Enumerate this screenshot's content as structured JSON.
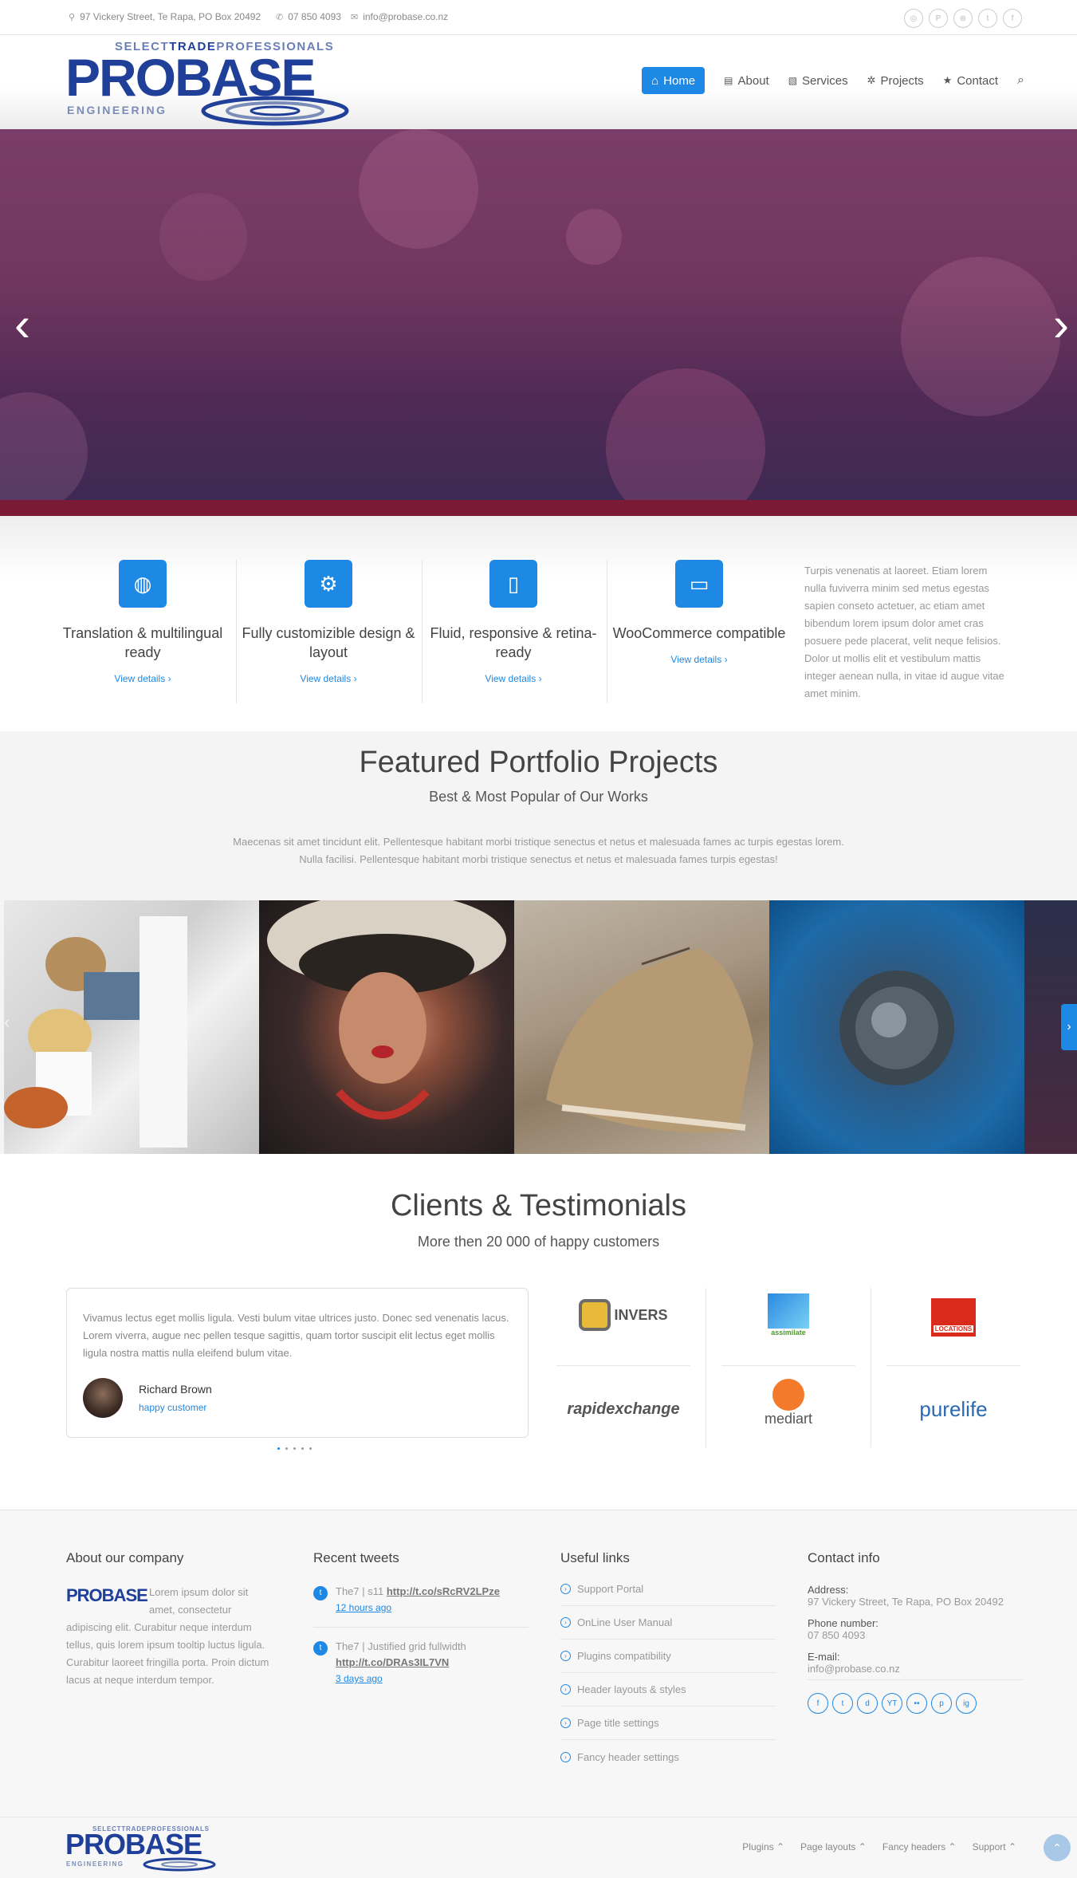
{
  "topbar": {
    "address": "97 Vickery Street, Te Rapa, PO Box 20492",
    "phone": "07 850 4093",
    "email": "info@probase.co.nz",
    "social_icons": [
      "instagram-icon",
      "pinterest-icon",
      "dribbble-icon",
      "twitter-icon",
      "facebook-icon"
    ]
  },
  "logo": {
    "tagline_select": "SELECT",
    "tagline_trade": "TRADE",
    "tagline_professionals": "PROFESSIONALS",
    "name": "PROBASE",
    "sub": "ENGINEERING"
  },
  "nav": {
    "items": [
      {
        "label": "Home",
        "icon": "home-icon",
        "active": true
      },
      {
        "label": "About",
        "icon": "document-icon"
      },
      {
        "label": "Services",
        "icon": "image-icon"
      },
      {
        "label": "Projects",
        "icon": "gear-icon"
      },
      {
        "label": "Contact",
        "icon": "star-icon"
      }
    ]
  },
  "features": [
    {
      "title": "Translation & multilingual ready",
      "link": "View details"
    },
    {
      "title": "Fully customizible design & layout",
      "link": "View details"
    },
    {
      "title": "Fluid, responsive & retina-ready",
      "link": "View details"
    },
    {
      "title": "WooCommerce compatible",
      "link": "View details"
    }
  ],
  "features_text": "Turpis venenatis at laoreet. Etiam lorem nulla fuviverra minim sed metus egestas sapien conseto actetuer, ac etiam amet bibendum lorem ipsum dolor amet cras posuere pede placerat, velit neque felisios. Dolor ut mollis elit et vestibulum mattis integer aenean nulla, in vitae id augue vitae amet minim.",
  "portfolio": {
    "title": "Featured Portfolio Projects",
    "subtitle": "Best & Most Popular of Our Works",
    "text_line1": "Maecenas sit amet tincidunt elit. Pellentesque habitant morbi tristique senectus et netus et malesuada fames ac turpis egestas lorem.",
    "text_line2": "Nulla facilisi. Pellentesque habitant morbi tristique senectus et netus et malesuada fames turpis egestas!"
  },
  "testimonials": {
    "title": "Clients & Testimonials",
    "subtitle": "More then 20 000 of happy customers",
    "quote": "Vivamus lectus eget mollis ligula. Vesti bulum vitae ultrices justo. Donec sed venenatis lacus. Lorem viverra, augue nec pellen tesque sagittis, quam tortor suscipit elit lectus eget mollis ligula nostra mattis nulla eleifend bulum vitae.",
    "name": "Richard Brown",
    "role": "happy customer",
    "clients": [
      "INVERS",
      "assimilate",
      "LOCATIONS",
      "rapidexchange",
      "mediart",
      "purelife"
    ]
  },
  "footer": {
    "about_title": "About our company",
    "about_text": "Lorem ipsum dolor sit amet, consectetur adipiscing elit. Curabitur neque interdum tellus, quis lorem ipsum tooltip luctus ligula. Curabitur laoreet fringilla porta. Proin dictum lacus at neque interdum tempor.",
    "tweets_title": "Recent tweets",
    "tweets": [
      {
        "text": "The7 | s11",
        "link": "http://t.co/sRcRV2LPze",
        "ago": "12 hours ago"
      },
      {
        "text": "The7 | Justified grid fullwidth",
        "link": "http://t.co/DRAs3IL7VN",
        "ago": "3 days ago"
      }
    ],
    "links_title": "Useful links",
    "links": [
      "Support Portal",
      "OnLine User Manual",
      "Plugins compatibility",
      "Header layouts & styles",
      "Page title settings",
      "Fancy header settings"
    ],
    "contact_title": "Contact info",
    "address_label": "Address:",
    "address": "97 Vickery Street, Te Rapa, PO Box 20492",
    "phone_label": "Phone number:",
    "phone": "07 850 4093",
    "email_label": "E-mail:",
    "email": "info@probase.co.nz",
    "social": [
      "f",
      "t",
      "d",
      "YT",
      "••",
      "p",
      "ig"
    ]
  },
  "bottom_nav": [
    "Plugins ⌃",
    "Page layouts ⌃",
    "Fancy headers ⌃",
    "Support ⌃"
  ],
  "colors": {
    "accent": "#1e88e5",
    "brand": "#1f3f98"
  }
}
